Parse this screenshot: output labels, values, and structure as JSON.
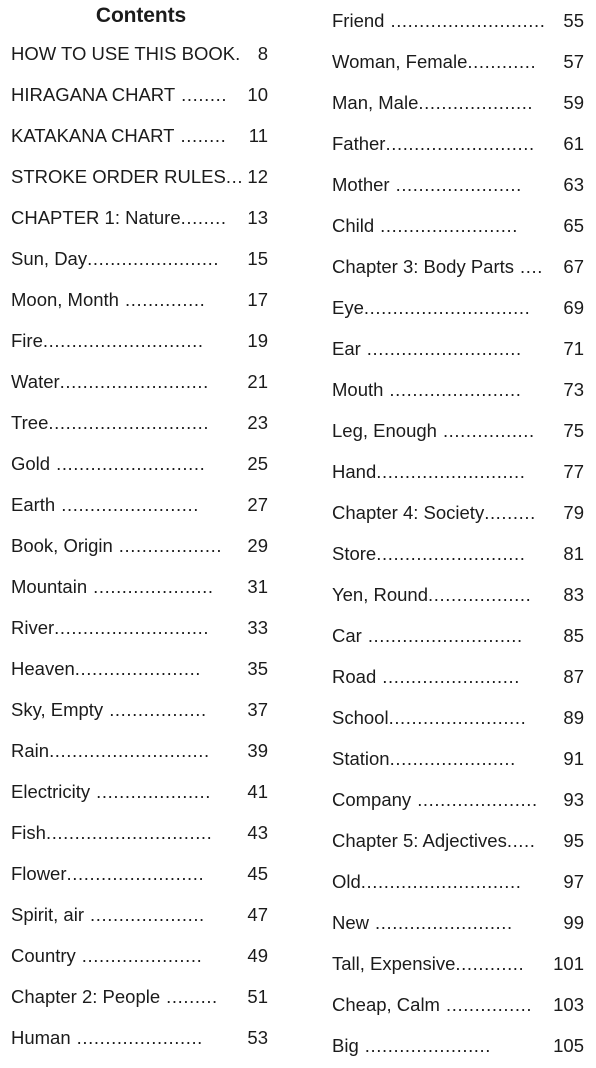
{
  "document": {
    "title": "Contents",
    "background_color": "#ffffff",
    "text_color": "#1b1b1b",
    "leader_char": "."
  },
  "columns": {
    "left": {
      "entries": [
        {
          "label": "HOW TO USE THIS BOOK",
          "page": "8",
          "leader": ".",
          "gap": "narrow"
        },
        {
          "label": "HIRAGANA CHART",
          "page": "10",
          "leader": "........",
          "gap": "wide"
        },
        {
          "label": "KATAKANA CHART",
          "page": "11",
          "leader": "........",
          "gap": "wide"
        },
        {
          "label": "STROKE ORDER RULES",
          "page": "12",
          "leader": "...",
          "gap": "narrow"
        },
        {
          "label": "CHAPTER 1: Nature",
          "page": "13",
          "leader": "........",
          "gap": "narrow"
        },
        {
          "label": "Sun, Day",
          "page": "15",
          "leader": ".......................",
          "gap": "narrow"
        },
        {
          "label": "Moon, Month",
          "page": "17",
          "leader": "..............",
          "gap": "wide"
        },
        {
          "label": "Fire",
          "page": "19",
          "leader": "............................",
          "gap": "narrow"
        },
        {
          "label": "Water",
          "page": "21",
          "leader": "..........................",
          "gap": "narrow"
        },
        {
          "label": "Tree",
          "page": "23",
          "leader": "............................",
          "gap": "narrow"
        },
        {
          "label": "Gold",
          "page": "25",
          "leader": "..........................",
          "gap": "wide"
        },
        {
          "label": "Earth",
          "page": "27",
          "leader": "........................",
          "gap": "wide"
        },
        {
          "label": "Book, Origin",
          "page": "29",
          "leader": "..................",
          "gap": "wide"
        },
        {
          "label": "Mountain",
          "page": "31",
          "leader": ".....................",
          "gap": "wide"
        },
        {
          "label": "River",
          "page": "33",
          "leader": "...........................",
          "gap": "narrow"
        },
        {
          "label": "Heaven",
          "page": "35",
          "leader": "......................",
          "gap": "narrow"
        },
        {
          "label": "Sky, Empty",
          "page": "37",
          "leader": ".................",
          "gap": "wide"
        },
        {
          "label": "Rain",
          "page": "39",
          "leader": "............................",
          "gap": "narrow"
        },
        {
          "label": "Electricity",
          "page": "41",
          "leader": "....................",
          "gap": "wide"
        },
        {
          "label": "Fish",
          "page": "43",
          "leader": ".............................",
          "gap": "narrow"
        },
        {
          "label": "Flower",
          "page": "45",
          "leader": "........................",
          "gap": "narrow"
        },
        {
          "label": "Spirit, air",
          "page": "47",
          "leader": "....................",
          "gap": "wide"
        },
        {
          "label": "Country",
          "page": "49",
          "leader": ".....................",
          "gap": "wide"
        },
        {
          "label": "Chapter 2: People",
          "page": "51",
          "leader": ".........",
          "gap": "wide"
        },
        {
          "label": "Human",
          "page": "53",
          "leader": "......................",
          "gap": "wide"
        }
      ]
    },
    "right": {
      "entries": [
        {
          "label": "Friend",
          "page": "55",
          "leader": "...........................",
          "gap": "wide"
        },
        {
          "label": "Woman, Female",
          "page": "57",
          "leader": "............",
          "gap": "narrow"
        },
        {
          "label": "Man, Male",
          "page": "59",
          "leader": "....................",
          "gap": "narrow"
        },
        {
          "label": "Father",
          "page": "61",
          "leader": "..........................",
          "gap": "narrow"
        },
        {
          "label": "Mother",
          "page": "63",
          "leader": "......................",
          "gap": "wide"
        },
        {
          "label": "Child",
          "page": "65",
          "leader": "........................",
          "gap": "wide"
        },
        {
          "label": "Chapter 3: Body Parts",
          "page": "67",
          "leader": "....",
          "gap": "wide"
        },
        {
          "label": "Eye",
          "page": "69",
          "leader": ".............................",
          "gap": "narrow"
        },
        {
          "label": "Ear",
          "page": "71",
          "leader": "...........................",
          "gap": "wide"
        },
        {
          "label": "Mouth",
          "page": "73",
          "leader": ".......................",
          "gap": "wide"
        },
        {
          "label": "Leg, Enough",
          "page": "75",
          "leader": "................",
          "gap": "wide"
        },
        {
          "label": "Hand",
          "page": "77",
          "leader": "..........................",
          "gap": "narrow"
        },
        {
          "label": "Chapter 4: Society",
          "page": "79",
          "leader": ".........",
          "gap": "narrow"
        },
        {
          "label": "Store",
          "page": "81",
          "leader": "..........................",
          "gap": "narrow"
        },
        {
          "label": "Yen, Round",
          "page": "83",
          "leader": "..................",
          "gap": "narrow"
        },
        {
          "label": "Car",
          "page": "85",
          "leader": "...........................",
          "gap": "wide"
        },
        {
          "label": "Road",
          "page": "87",
          "leader": "........................",
          "gap": "wide"
        },
        {
          "label": "School",
          "page": "89",
          "leader": "........................",
          "gap": "narrow"
        },
        {
          "label": "Station",
          "page": "91",
          "leader": "......................",
          "gap": "narrow"
        },
        {
          "label": "Company",
          "page": "93",
          "leader": ".....................",
          "gap": "wide"
        },
        {
          "label": "Chapter 5: Adjectives",
          "page": "95",
          "leader": ".....",
          "gap": "narrow"
        },
        {
          "label": "Old",
          "page": "97",
          "leader": "............................",
          "gap": "narrow"
        },
        {
          "label": "New",
          "page": "99",
          "leader": "........................",
          "gap": "wide"
        },
        {
          "label": "Tall, Expensive",
          "page": "101",
          "leader": "............",
          "gap": "narrow"
        },
        {
          "label": "Cheap, Calm",
          "page": "103",
          "leader": "...............",
          "gap": "wide"
        },
        {
          "label": "Big",
          "page": "105",
          "leader": "......................",
          "gap": "wide"
        }
      ]
    }
  }
}
